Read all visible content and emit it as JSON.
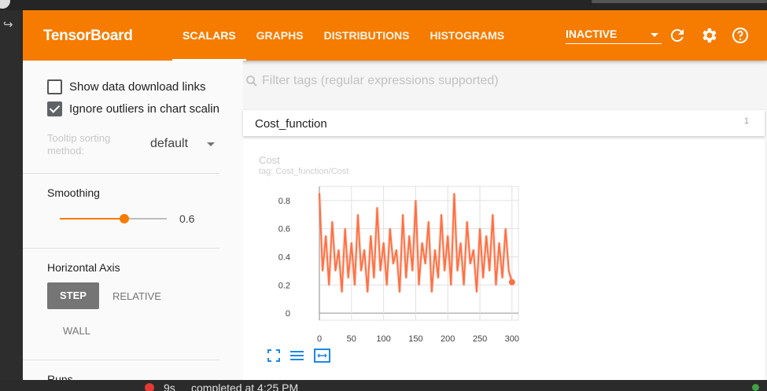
{
  "header": {
    "title": "TensorBoard",
    "tabs": [
      {
        "label": "SCALARS",
        "active": true
      },
      {
        "label": "GRAPHS",
        "active": false
      },
      {
        "label": "DISTRIBUTIONS",
        "active": false
      },
      {
        "label": "HISTOGRAMS",
        "active": false
      }
    ],
    "status_select": "INACTIVE",
    "icons": [
      "refresh-icon",
      "settings-icon",
      "help-icon"
    ],
    "accent_color": "#f57c00"
  },
  "sidebar": {
    "show_download_links": {
      "label": "Show data download links",
      "checked": false
    },
    "ignore_outliers": {
      "label": "Ignore outliers in chart scaling",
      "checked": true
    },
    "tooltip_sorting": {
      "label": "Tooltip sorting method:",
      "value": "default"
    },
    "smoothing": {
      "title": "Smoothing",
      "value": 0.6,
      "value_label": "0.6"
    },
    "horizontal_axis": {
      "title": "Horizontal Axis",
      "options": [
        "STEP",
        "RELATIVE",
        "WALL"
      ],
      "selected": "STEP"
    },
    "runs_title": "Runs"
  },
  "main": {
    "filter_placeholder": "Filter tags (regular expressions supported)",
    "category": {
      "name": "Cost_function",
      "count": "1"
    },
    "card": {
      "title": "Cost",
      "tag": "tag: Cost_function/Cost"
    }
  },
  "chart_data": {
    "type": "line",
    "title": "Cost",
    "xlabel": "",
    "ylabel": "",
    "x_ticks": [
      0,
      50,
      100,
      150,
      200,
      250,
      300
    ],
    "y_ticks": [
      0,
      0.2,
      0.4,
      0.6,
      0.8
    ],
    "xlim": [
      0,
      310
    ],
    "ylim": [
      -0.05,
      0.9
    ],
    "grid": true,
    "series_color": "#ff7043",
    "series": [
      {
        "name": "",
        "x": [
          0,
          5,
          10,
          15,
          20,
          25,
          30,
          35,
          40,
          45,
          50,
          55,
          60,
          65,
          70,
          75,
          80,
          85,
          90,
          95,
          100,
          105,
          110,
          115,
          120,
          125,
          130,
          135,
          140,
          145,
          150,
          155,
          160,
          165,
          170,
          175,
          180,
          185,
          190,
          195,
          200,
          205,
          210,
          215,
          220,
          225,
          230,
          235,
          240,
          245,
          250,
          255,
          260,
          265,
          270,
          275,
          280,
          285,
          290,
          295,
          300
        ],
        "values": [
          0.85,
          0.3,
          0.55,
          0.2,
          0.65,
          0.3,
          0.45,
          0.15,
          0.6,
          0.25,
          0.5,
          0.2,
          0.7,
          0.3,
          0.45,
          0.15,
          0.55,
          0.25,
          0.75,
          0.3,
          0.5,
          0.2,
          0.6,
          0.35,
          0.45,
          0.15,
          0.7,
          0.25,
          0.55,
          0.3,
          0.8,
          0.2,
          0.5,
          0.35,
          0.65,
          0.15,
          0.45,
          0.25,
          0.7,
          0.3,
          0.55,
          0.2,
          0.85,
          0.3,
          0.5,
          0.2,
          0.65,
          0.35,
          0.45,
          0.15,
          0.6,
          0.25,
          0.55,
          0.3,
          0.7,
          0.2,
          0.5,
          0.25,
          0.6,
          0.3,
          0.22
        ]
      }
    ]
  },
  "statusbar": {
    "duration": "9s",
    "message": "completed at 4:25 PM"
  }
}
